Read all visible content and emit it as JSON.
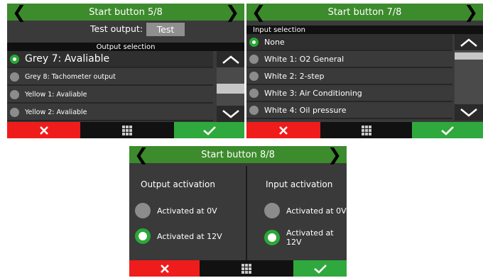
{
  "screen1": {
    "title": "Start button 5/8",
    "test_output_label": "Test output:",
    "test_button": "Test",
    "section_label": "Output selection",
    "items": [
      {
        "label": "Grey 7: Avaliable",
        "selected": true
      },
      {
        "label": "Grey 8: Tachometer output",
        "selected": false
      },
      {
        "label": "Yellow 1: Avaliable",
        "selected": false
      },
      {
        "label": "Yellow 2: Avaliable",
        "selected": false
      }
    ]
  },
  "screen2": {
    "title": "Start button 7/8",
    "section_label": "Input selection",
    "items": [
      {
        "label": "None",
        "selected": true
      },
      {
        "label": "White 1: O2 General",
        "selected": false
      },
      {
        "label": "White 2: 2-step",
        "selected": false
      },
      {
        "label": "White 3: Air Conditioning",
        "selected": false
      },
      {
        "label": "White 4: Oil pressure",
        "selected": false
      }
    ]
  },
  "screen3": {
    "title": "Start button 8/8",
    "output": {
      "heading": "Output activation",
      "options": [
        {
          "label": "Activated at 0V",
          "selected": false
        },
        {
          "label": "Activated at 12V",
          "selected": true
        }
      ]
    },
    "input": {
      "heading": "Input activation",
      "options": [
        {
          "label": "Activated at 0V",
          "selected": false
        },
        {
          "label": "Activated at 12V",
          "selected": true
        }
      ]
    }
  },
  "icons": {
    "prev": "chevron-left-icon",
    "next": "chevron-right-icon",
    "scroll_up": "chevron-up-icon",
    "scroll_down": "chevron-down-icon",
    "cancel": "close-icon",
    "menu": "grid-menu-icon",
    "confirm": "checkmark-icon"
  },
  "colors": {
    "header_green": "#3c8b2c",
    "cancel_red": "#ef1c1c",
    "confirm_green": "#2fa83d",
    "radio_selected": "#2aa836",
    "panel_bg": "#3a3a3a"
  }
}
